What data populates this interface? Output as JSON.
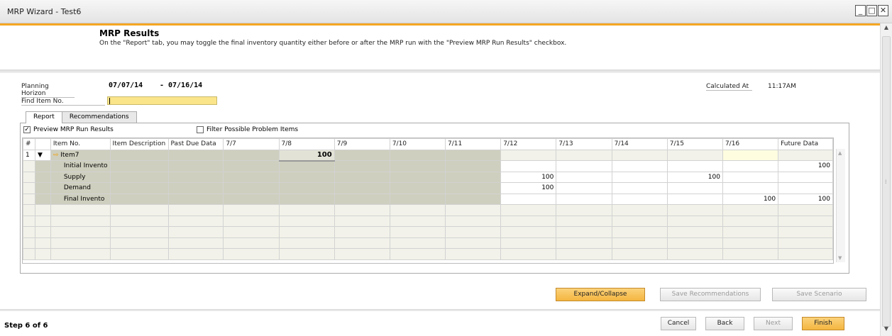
{
  "window": {
    "title": "MRP Wizard - Test6"
  },
  "header": {
    "title": "MRP Results",
    "description": "On the \"Report\" tab, you may toggle the final inventory quantity either before or after the MRP run with the \"Preview MRP Run Results\" checkbox."
  },
  "form": {
    "planning_horizon_label": "Planning Horizon",
    "from_date": "07/07/14",
    "dash": "-",
    "to_date": "07/16/14",
    "calculated_at_label": "Calculated At",
    "calculated_at_value": "11:17AM",
    "find_item_label": "Find Item No.",
    "find_item_value": ""
  },
  "tabs": [
    {
      "label": "Report"
    },
    {
      "label": "Recommendations"
    }
  ],
  "options": {
    "preview_label": "Preview MRP Run Results",
    "preview_checked": true,
    "filter_label": "Filter Possible Problem Items",
    "filter_checked": false
  },
  "table": {
    "columns": [
      "#",
      "",
      "Item No.",
      "Item Description",
      "Past Due Data",
      "7/7",
      "7/8",
      "7/9",
      "7/10",
      "7/11",
      "7/12",
      "7/13",
      "7/14",
      "7/15",
      "7/16",
      "Future Data"
    ],
    "rows": [
      {
        "num": "1",
        "expander": "▼",
        "item": "Item7",
        "cells": [
          "",
          "",
          "",
          "100",
          "",
          "",
          "",
          "",
          "",
          "",
          "",
          "",
          ""
        ]
      },
      {
        "num": "",
        "expander": "",
        "item": "Initial Invento",
        "cells": [
          "",
          "",
          "",
          "",
          "",
          "",
          "",
          "",
          "",
          "",
          "",
          "",
          "100"
        ]
      },
      {
        "num": "",
        "expander": "",
        "item": "Supply",
        "cells": [
          "",
          "",
          "",
          "",
          "",
          "",
          "",
          "100",
          "",
          "",
          "100",
          "",
          ""
        ]
      },
      {
        "num": "",
        "expander": "",
        "item": "Demand",
        "cells": [
          "",
          "",
          "",
          "",
          "",
          "",
          "",
          "100",
          "",
          "",
          "",
          "",
          ""
        ]
      },
      {
        "num": "",
        "expander": "",
        "item": "Final Invento",
        "cells": [
          "",
          "",
          "",
          "",
          "",
          "",
          "",
          "",
          "",
          "",
          "",
          "100",
          "100"
        ]
      }
    ]
  },
  "buttons": {
    "expand_collapse": "Expand/Collapse",
    "save_recommendations": "Save Recommendations",
    "save_scenario": "Save Scenario",
    "cancel": "Cancel",
    "back": "Back",
    "next": "Next",
    "finish": "Finish"
  },
  "footer": {
    "step": "Step 6 of 6"
  },
  "icons": {
    "arrow": "item-arrow-icon",
    "checkmark": "check-icon"
  }
}
